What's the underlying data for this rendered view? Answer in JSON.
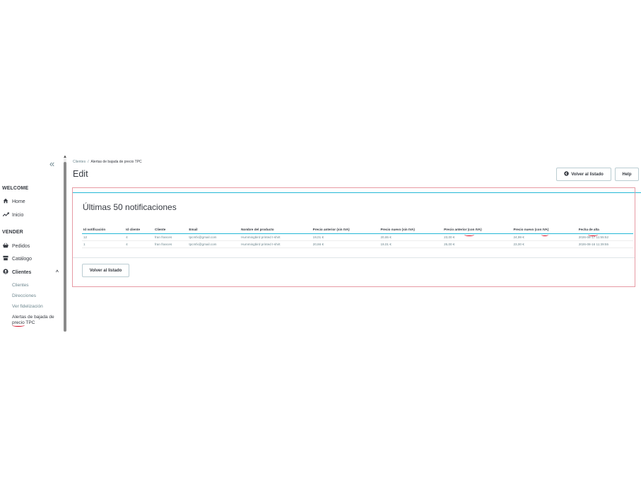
{
  "sidebar": {
    "collapse_icon": "«",
    "sections": {
      "welcome": "WELCOME",
      "vender": "VENDER"
    },
    "welcome_items": [
      {
        "label": "Home",
        "icon": "home-icon"
      },
      {
        "label": "Inicio",
        "icon": "trending-icon"
      }
    ],
    "vender_items": [
      {
        "label": "Pedidos",
        "icon": "basket-icon"
      },
      {
        "label": "Catálogo",
        "icon": "store-icon"
      },
      {
        "label": "Clientes",
        "icon": "account-circle-icon",
        "expanded": true
      }
    ],
    "clientes_sub": [
      "Clientes",
      "Direcciones",
      "Ver fidelización",
      "Alertas de bajada de precio TPC"
    ]
  },
  "breadcrumb": {
    "parent": "Clientes",
    "separator": "/",
    "current": "Alertas de bajada de precio TPC"
  },
  "header": {
    "title": "Edit",
    "back_button": "Volver al listado",
    "help_button": "Help"
  },
  "panel": {
    "title": "Últimas 50 notificaciones",
    "columns": [
      "Id notificación",
      "Id cliente",
      "Cliente",
      "Email",
      "Nombre del producto",
      "Precio anterior (sin IVA)",
      "Precio nuevo (sin IVA)",
      "Precio anterior (con IVA)",
      "Precio nuevo (con IVA)",
      "Fecha de alta"
    ],
    "rows": [
      [
        "12",
        "4",
        "fran frances",
        "tpcmfx@gmail.com",
        "Hummingbird printed t-shirt",
        "19,01 €",
        "20,65 €",
        "23,00 €",
        "24,99 €",
        "2026-08-17 11:55:52"
      ],
      [
        "1",
        "4",
        "fran frances",
        "tpcmfx@gmail.com",
        "Hummingbird printed t-shirt",
        "20,66 €",
        "19,01 €",
        "25,00 €",
        "23,00 €",
        "2026-08-16 11:39:55"
      ]
    ],
    "back_button": "Volver al listado"
  },
  "colors": {
    "accent": "#25b9d7",
    "annotation_red": "#d0021b",
    "panel_border": "#e79aa4"
  }
}
